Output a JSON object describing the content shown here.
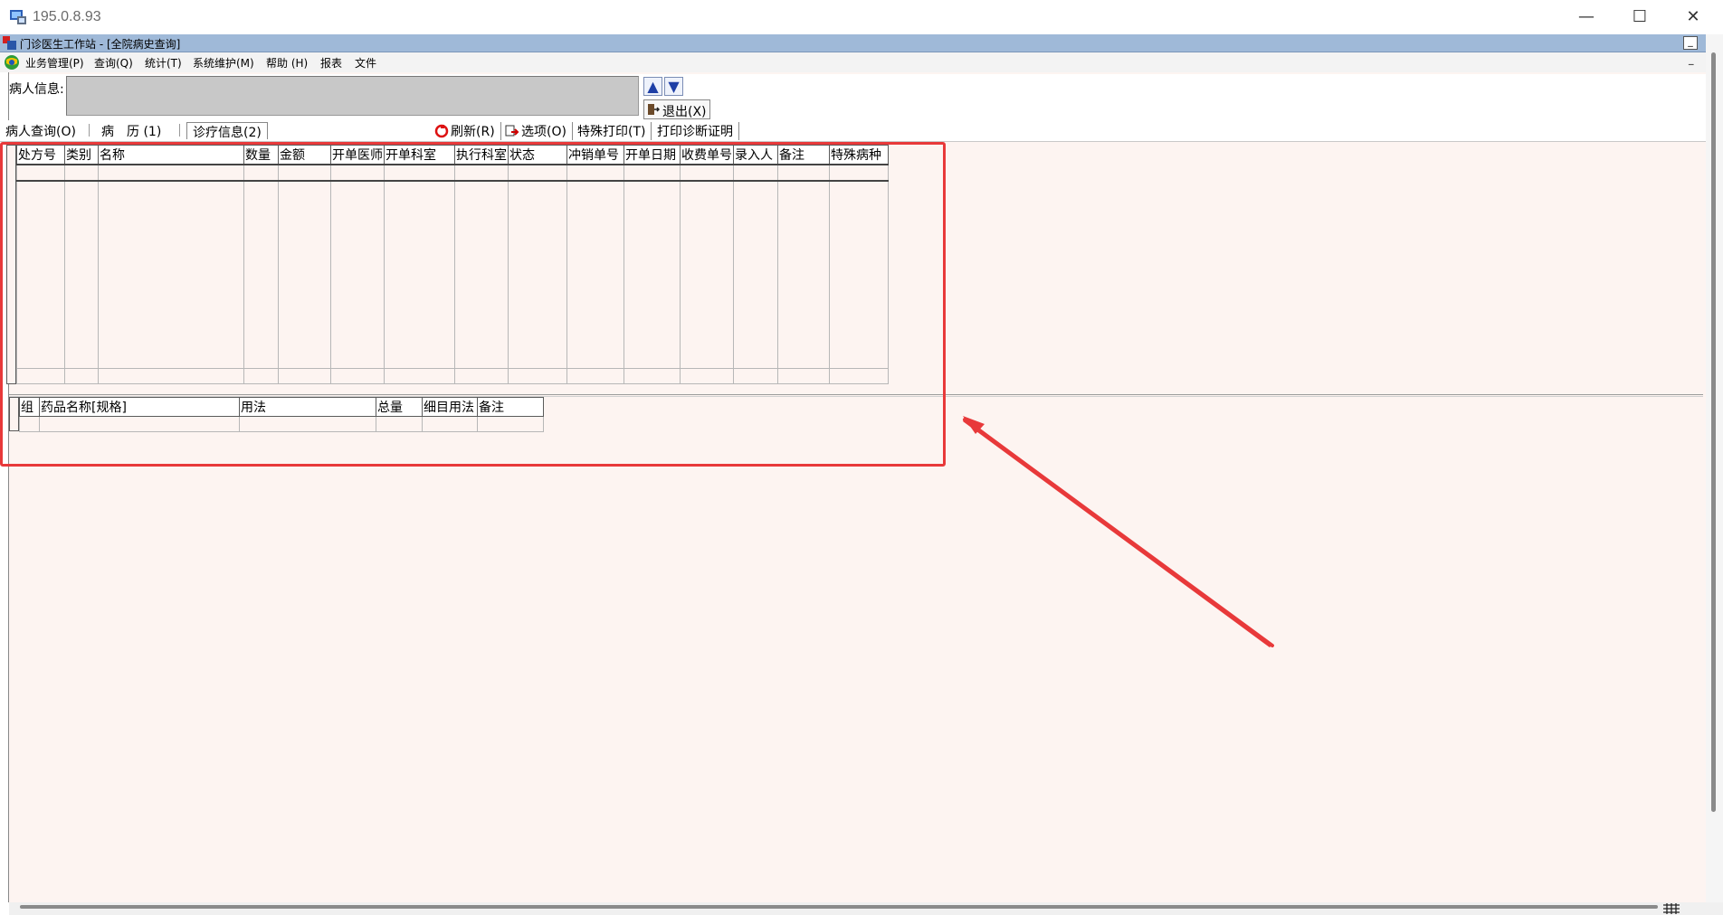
{
  "window": {
    "title": "195.0.8.93",
    "minimize": "—",
    "maximize": "☐",
    "close": "✕"
  },
  "mdi": {
    "title": "门诊医生工作站 - [全院病史查询]",
    "minimize": "_"
  },
  "menu": [
    "业务管理(P)",
    "查询(Q)",
    "统计(T)",
    "系统维护(M)",
    "帮助 (H)",
    "报表",
    "文件"
  ],
  "patient": {
    "label": "病人信息:",
    "value": ""
  },
  "nav": {
    "up": "▲",
    "down": "▼",
    "exit": "退出(X)"
  },
  "tabs": [
    "病人查询(O)",
    "病　历 (1)",
    "诊疗信息(2)"
  ],
  "toolbar": {
    "refresh": "刷新(R)",
    "options": "选项(O)",
    "special_print": "特殊打印(T)",
    "print_cert": "打印诊断证明"
  },
  "grid1": {
    "headers": [
      "处方号",
      "类别",
      "名称",
      "数量",
      "金额",
      "开单医师",
      "开单科室",
      "执行科室",
      "状态",
      "冲销单号",
      "开单日期",
      "收费单号",
      "录入人",
      "备注",
      "特殊病种"
    ]
  },
  "grid2": {
    "headers": [
      "组",
      "药品名称[规格]",
      "用法",
      "总量",
      "细目用法",
      "备注"
    ]
  },
  "colors": {
    "highlight": "#e8393a",
    "mdi_bar": "#9fb9d8",
    "content_bg": "#fdf4f1"
  }
}
